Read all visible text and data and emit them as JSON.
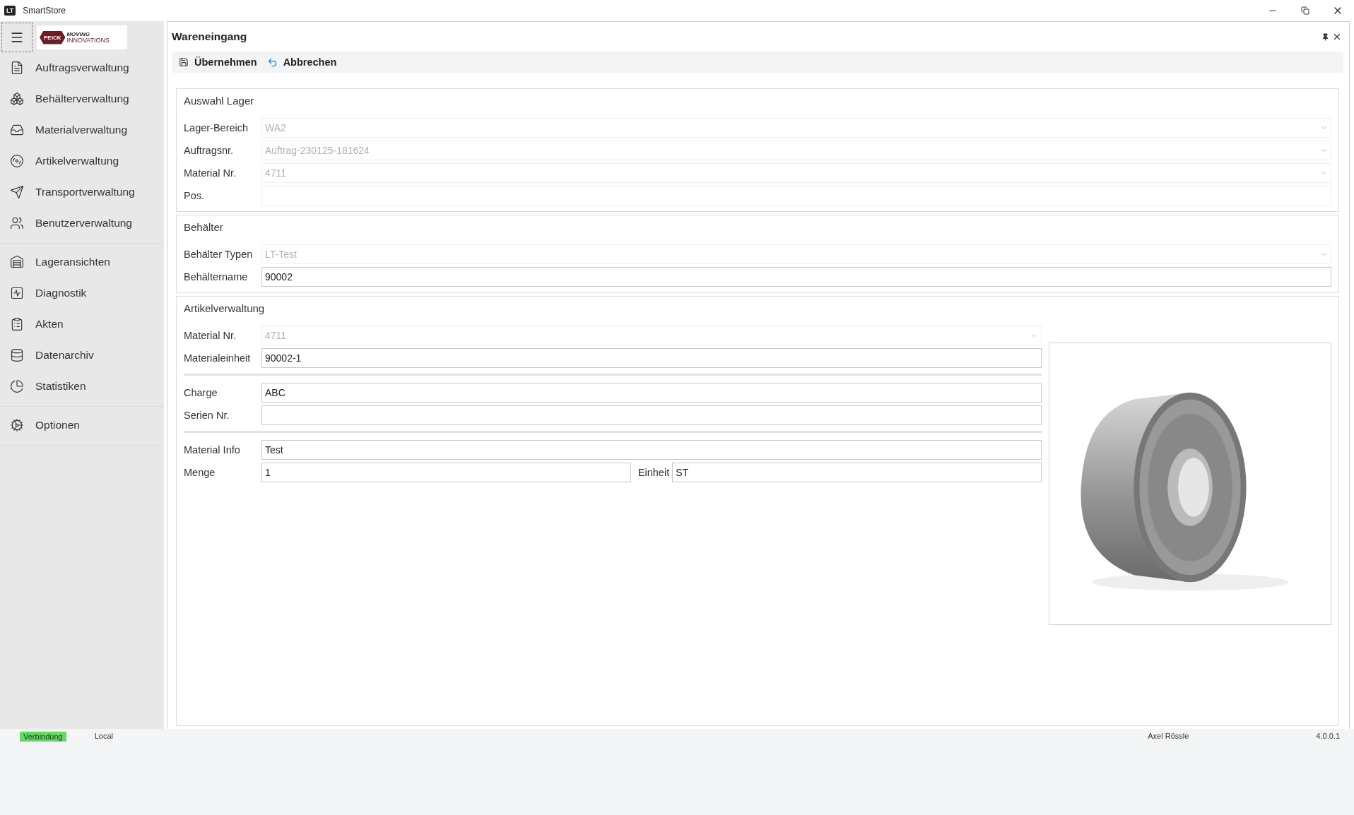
{
  "window": {
    "app_icon": "LT",
    "title": "SmartStore"
  },
  "sidebar": {
    "logo": {
      "mark": "PEICK",
      "line1": "MOVING",
      "line2": "INNOVATIONS"
    },
    "groups": [
      [
        {
          "label": "Auftragsverwaltung"
        },
        {
          "label": "Behälterverwaltung"
        },
        {
          "label": "Materialverwaltung"
        },
        {
          "label": "Artikelverwaltung"
        },
        {
          "label": "Transportverwaltung"
        },
        {
          "label": "Benutzerverwaltung"
        }
      ],
      [
        {
          "label": "Lageransichten"
        },
        {
          "label": "Diagnostik"
        },
        {
          "label": "Akten"
        },
        {
          "label": "Datenarchiv"
        },
        {
          "label": "Statistiken"
        }
      ],
      [
        {
          "label": "Optionen"
        }
      ]
    ]
  },
  "main": {
    "title": "Wareneingang",
    "toolbar": [
      {
        "label": "Übernehmen"
      },
      {
        "label": "Abbrechen"
      }
    ],
    "groups": [
      {
        "title": "Auswahl Lager",
        "sections": [
          [
            {
              "label": "Lager-Bereich",
              "value": "WA2",
              "kind": "combo",
              "disabled": true
            },
            {
              "label": "Auftragsnr.",
              "value": "Auftrag-230125-181624",
              "kind": "combo",
              "disabled": true
            },
            {
              "label": "Material Nr.",
              "value": "4711",
              "kind": "combo",
              "disabled": true
            },
            {
              "label": "Pos.",
              "kind": "text",
              "disabled": true
            }
          ]
        ]
      },
      {
        "title": "Behälter",
        "sections": [
          [
            {
              "label": "Behälter Typen",
              "value": "LT-Test",
              "kind": "combo",
              "disabled": true
            },
            {
              "label": "Behältername",
              "value": "90002",
              "kind": "text",
              "disabled": false
            }
          ]
        ]
      },
      {
        "title": "Artikelverwaltung",
        "picture": {
          "kind": "picture"
        },
        "sections": [
          [
            {
              "label": "Material Nr.",
              "value": "4711",
              "kind": "combo",
              "disabled": true
            },
            {
              "label": "Materialeinheit",
              "value": "90002-1",
              "kind": "text",
              "disabled": false
            }
          ],
          [
            {
              "label": "Charge",
              "value": "ABC",
              "kind": "text",
              "disabled": false
            },
            {
              "label": "Serien Nr.",
              "kind": "text",
              "disabled": false
            }
          ],
          [
            {
              "label": "Material Info",
              "value": "Test",
              "kind": "text",
              "disabled": false
            },
            {
              "label": "Menge",
              "value": "1",
              "kind": "text",
              "disabled": false,
              "unit": {
                "label": "Einheit",
                "value": "ST"
              }
            }
          ]
        ]
      }
    ]
  },
  "status_bar": {
    "connection": {
      "label": "Verbindung",
      "connected": true
    },
    "mode": "Local",
    "user": "Axel Rössle",
    "version": "4.0.0.1"
  }
}
